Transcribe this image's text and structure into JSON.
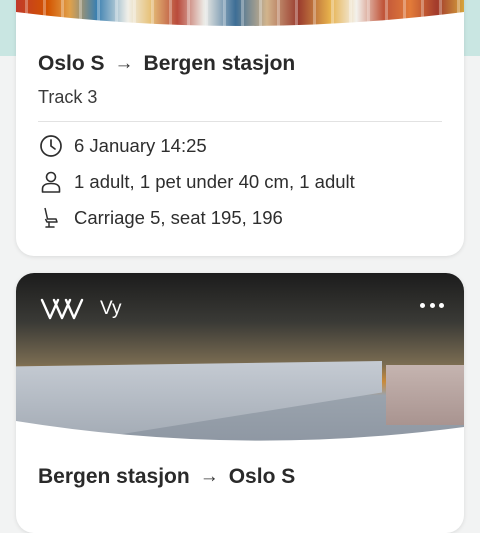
{
  "colors": {
    "background": "#f2f3f3",
    "card": "#ffffff",
    "accent_mint": "#c9e6e2",
    "text": "#2b2b2b"
  },
  "ticket1": {
    "from": "Oslo S",
    "to": "Bergen stasjon",
    "arrow_icon": "arrow-right-icon",
    "track": "Track 3",
    "datetime": "6 January 14:25",
    "passengers": "1 adult, 1 pet under 40 cm, 1 adult",
    "seat": "Carriage 5, seat 195, 196",
    "icons": [
      "clock-icon",
      "person-icon",
      "seat-icon"
    ]
  },
  "ticket2": {
    "operator": "Vy",
    "logo_icon": "vy-logo-icon",
    "menu_icon": "more-options-icon",
    "from": "Bergen stasjon",
    "to": "Oslo S"
  }
}
